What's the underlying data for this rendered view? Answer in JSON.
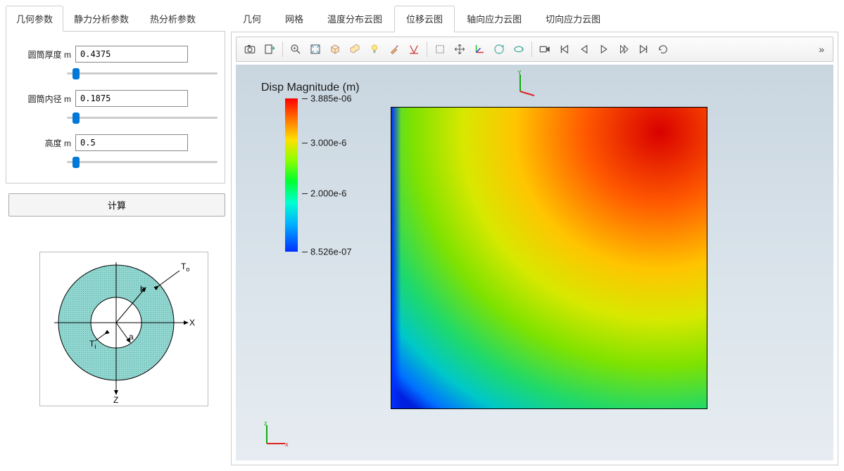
{
  "leftTabs": [
    {
      "id": "geom",
      "label": "几何参数",
      "active": true
    },
    {
      "id": "static",
      "label": "静力分析参数",
      "active": false
    },
    {
      "id": "thermal",
      "label": "热分析参数",
      "active": false
    }
  ],
  "params": [
    {
      "id": "thickness",
      "label": "圆筒厚度 m",
      "value": "0.4375"
    },
    {
      "id": "innerRadius",
      "label": "圆筒内径 m",
      "value": "0.1875"
    },
    {
      "id": "height",
      "label": "高度 m",
      "value": "0.5"
    }
  ],
  "calcBtn": "计算",
  "viewTabs": [
    {
      "id": "geo",
      "label": "几何",
      "active": false
    },
    {
      "id": "mesh",
      "label": "网格",
      "active": false
    },
    {
      "id": "temp",
      "label": "温度分布云图",
      "active": false
    },
    {
      "id": "disp",
      "label": "位移云图",
      "active": true
    },
    {
      "id": "axial",
      "label": "轴向应力云图",
      "active": false
    },
    {
      "id": "tang",
      "label": "切向应力云图",
      "active": false
    }
  ],
  "toolbar": [
    {
      "name": "camera-icon",
      "group": 0
    },
    {
      "name": "export-icon",
      "group": 0
    },
    {
      "name": "zoom-icon",
      "group": 1
    },
    {
      "name": "fit-icon",
      "group": 1
    },
    {
      "name": "cube-icon",
      "group": 1
    },
    {
      "name": "cubes-icon",
      "group": 1
    },
    {
      "name": "lightbulb-icon",
      "group": 1
    },
    {
      "name": "brush-icon",
      "group": 1
    },
    {
      "name": "ruler-icon",
      "group": 1
    },
    {
      "name": "select-rect-icon",
      "group": 2
    },
    {
      "name": "move-icon",
      "group": 2
    },
    {
      "name": "axes-icon",
      "group": 2
    },
    {
      "name": "rotate-x-icon",
      "group": 2
    },
    {
      "name": "rotate-y-icon",
      "group": 2
    },
    {
      "name": "video-icon",
      "group": 3
    },
    {
      "name": "first-frame-icon",
      "group": 3
    },
    {
      "name": "prev-frame-icon",
      "group": 3
    },
    {
      "name": "play-icon",
      "group": 3
    },
    {
      "name": "next-frame-icon",
      "group": 3
    },
    {
      "name": "last-frame-icon",
      "group": 3
    },
    {
      "name": "loop-icon",
      "group": 3
    }
  ],
  "legend": {
    "title": "Disp Magnitude (m)",
    "ticks": [
      {
        "value": "3.885e-06",
        "pos": 0
      },
      {
        "value": "3.000e-6",
        "pos": 0.29
      },
      {
        "value": "2.000e-6",
        "pos": 0.62
      },
      {
        "value": "8.526e-07",
        "pos": 1.0
      }
    ]
  },
  "diagram": {
    "labels": {
      "outerTemp": "T",
      "innerTemp": "T",
      "x": "X",
      "z": "Z",
      "a": "a",
      "b": "b",
      "oSub": "o",
      "iSub": "i"
    }
  },
  "chart_data": {
    "type": "heatmap",
    "title": "Disp Magnitude (m)",
    "colorbar_range": [
      8.526e-07,
      3.885e-06
    ],
    "colorbar_ticks": [
      8.526e-07,
      2e-06,
      3e-06,
      3.885e-06
    ],
    "description": "2D displacement magnitude contour of axisymmetric cylinder cross-section; high (red ~3.9e-6 m) at top-right, low (blue ~8.5e-7 m) at bottom-left, smooth gradient through green/yellow."
  }
}
